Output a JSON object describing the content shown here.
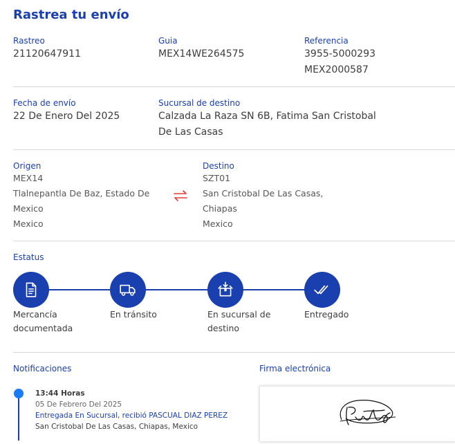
{
  "page": {
    "title": "Rastrea tu envío"
  },
  "summary": {
    "tracking_label": "Rastreo",
    "tracking_value": "21120647911",
    "guide_label": "Guia",
    "guide_value": "MEX14WE264575",
    "reference_label": "Referencia",
    "reference_line1": "3955-5000293",
    "reference_line2": "MEX2000587"
  },
  "shipping": {
    "date_label": "Fecha de envío",
    "date_value": "22 De Enero Del 2025",
    "branch_label": "Sucursal de destino",
    "branch_line1": "Calzada La Raza SN 6B, Fatima San Cristobal",
    "branch_line2": "De Las Casas"
  },
  "route": {
    "origin_label": "Origen",
    "origin_code": "MEX14",
    "origin_line1": "Tlalnepantla De Baz, Estado De",
    "origin_line2": "Mexico",
    "origin_country": "Mexico",
    "destination_label": "Destino",
    "destination_code": "SZT01",
    "destination_line1": "San Cristobal De Las Casas,",
    "destination_line2": "Chiapas",
    "destination_country": "Mexico",
    "swap_icon": "swap-arrows-icon",
    "swap_color": "#e53935"
  },
  "status": {
    "label": "Estatus",
    "accent": "#1a3fae",
    "steps": [
      {
        "line1": "Mercancía",
        "line2": "documentada",
        "icon": "document-icon"
      },
      {
        "line1": "En tránsito",
        "line2": "",
        "icon": "truck-icon"
      },
      {
        "line1": "En sucursal de",
        "line2": "destino",
        "icon": "package-icon"
      },
      {
        "line1": "Entregado",
        "line2": "",
        "icon": "double-check-icon"
      }
    ]
  },
  "notifications": {
    "label": "Notificaciones",
    "items": [
      {
        "time": "13:44 Horas",
        "date": "05 De Febrero Del 2025",
        "event": "Entregada En Sucursal, recibió PASCUAL DIAZ PEREZ",
        "location": "San Cristobal De Las Casas, Chiapas, Mexico"
      }
    ]
  },
  "signature": {
    "label": "Firma electrónica",
    "icon": "handwritten-signature"
  }
}
